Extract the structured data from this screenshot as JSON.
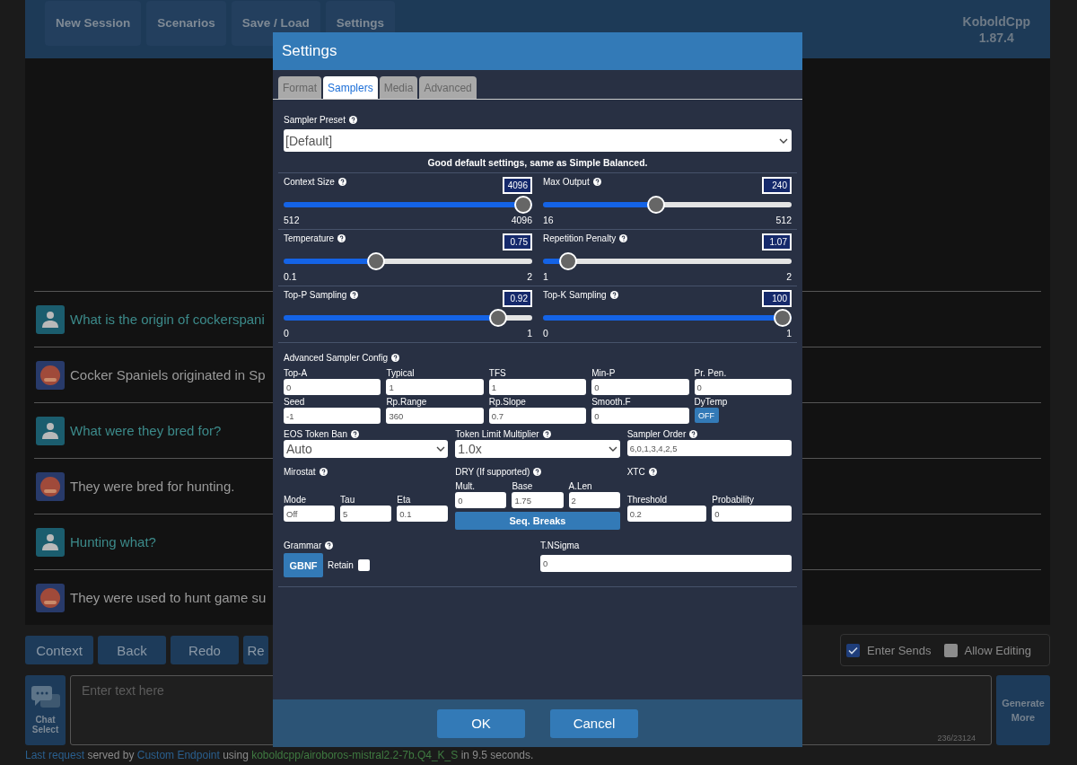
{
  "header": {
    "nav": [
      "New Session",
      "Scenarios",
      "Save / Load",
      "Settings"
    ],
    "brand": "KoboldCpp",
    "version": "1.87.4"
  },
  "messages": [
    {
      "kind": "user",
      "text": "What is the origin of cockerspani"
    },
    {
      "kind": "bot",
      "text": "Cocker Spaniels originated in Sp"
    },
    {
      "kind": "user",
      "text": "What were they bred for?"
    },
    {
      "kind": "bot",
      "text": "They were bred for hunting."
    },
    {
      "kind": "user",
      "text": "Hunting what?"
    },
    {
      "kind": "bot",
      "text": "They were used to hunt game su"
    }
  ],
  "actions": [
    "Context",
    "Back",
    "Redo",
    "Re"
  ],
  "options": [
    {
      "label": "Enter Sends",
      "checked": true
    },
    {
      "label": "Allow Editing",
      "checked": false
    }
  ],
  "chat_select": "Chat Select",
  "input": {
    "placeholder": "Enter text here",
    "counter": "236/23124"
  },
  "generate_button": "Generate More",
  "status": [
    {
      "kind": "link",
      "text": "Last request"
    },
    {
      "kind": "plain",
      "text": " served by "
    },
    {
      "kind": "link",
      "text": "Custom Endpoint"
    },
    {
      "kind": "plain",
      "text": " using "
    },
    {
      "kind": "model",
      "text": "koboldcpp/airoboros-mistral2.2-7b.Q4_K_S"
    },
    {
      "kind": "plain",
      "text": " in 9.5 seconds."
    }
  ],
  "modal": {
    "title": "Settings",
    "tabs": [
      {
        "label": "Format",
        "selected": false
      },
      {
        "label": "Samplers",
        "selected": true
      },
      {
        "label": "Media",
        "selected": false
      },
      {
        "label": "Advanced",
        "selected": false
      }
    ],
    "preset": {
      "label": "Sampler Preset",
      "value": "[Default]",
      "note": "Good default settings, same as Simple Balanced."
    },
    "sliders": [
      {
        "label": "Context Size",
        "value": "4096",
        "min": "512",
        "max": "4096",
        "level": 1.0
      },
      {
        "label": "Max Output",
        "value": "240",
        "min": "16",
        "max": "512",
        "level": 0.45
      },
      {
        "label": "Temperature",
        "value": "0.75",
        "min": "0.1",
        "max": "2",
        "level": 0.36
      },
      {
        "label": "Repetition Penalty",
        "value": "1.07",
        "min": "1",
        "max": "2",
        "level": 0.07
      },
      {
        "label": "Top-P Sampling",
        "value": "0.92",
        "min": "0",
        "max": "1",
        "level": 0.89
      },
      {
        "label": "Top-K Sampling",
        "value": "100",
        "min": "0",
        "max": "1",
        "level": 1.0
      }
    ],
    "advanced_title": "Advanced Sampler Config",
    "grid": [
      {
        "kind": "input",
        "label": "Top-A",
        "value": "0"
      },
      {
        "kind": "input",
        "label": "Typical",
        "value": "1"
      },
      {
        "kind": "input",
        "label": "TFS",
        "value": "1"
      },
      {
        "kind": "input",
        "label": "Min-P",
        "value": "0"
      },
      {
        "kind": "input",
        "label": "Pr. Pen.",
        "value": "0"
      },
      {
        "kind": "input",
        "label": "Seed",
        "value": "-1"
      },
      {
        "kind": "input",
        "label": "Rp.Range",
        "value": "360"
      },
      {
        "kind": "input",
        "label": "Rp.Slope",
        "value": "0.7"
      },
      {
        "kind": "input",
        "label": "Smooth.F",
        "value": "0"
      },
      {
        "kind": "toggle",
        "label": "DyTemp",
        "value": "OFF",
        "on": false
      }
    ],
    "row3": [
      {
        "kind": "select",
        "label": "EOS Token Ban",
        "value": "Auto"
      },
      {
        "kind": "select",
        "label": "Token Limit Multiplier",
        "value": "1.0x"
      },
      {
        "kind": "input",
        "label": "Sampler Order",
        "value": "6,0,1,3,4,2,5"
      }
    ],
    "mirostat": {
      "title": "Mirostat",
      "fields": [
        {
          "label": "Mode",
          "value": "Off"
        },
        {
          "label": "Tau",
          "value": "5"
        },
        {
          "label": "Eta",
          "value": "0.1"
        }
      ]
    },
    "dry": {
      "title": "DRY (If supported)",
      "fields": [
        {
          "label": "Mult.",
          "value": "0"
        },
        {
          "label": "Base",
          "value": "1.75"
        },
        {
          "label": "A.Len",
          "value": "2"
        }
      ],
      "button": "Seq. Breaks"
    },
    "xtc": {
      "title": "XTC",
      "fields": [
        {
          "label": "Threshold",
          "value": "0.2"
        },
        {
          "label": "Probability",
          "value": "0"
        }
      ]
    },
    "grammar": {
      "title": "Grammar",
      "button": "GBNF",
      "retain_label": "Retain",
      "retain": false
    },
    "nsigma": {
      "label": "T.NSigma",
      "value": "0"
    },
    "buttons": [
      "OK",
      "Cancel"
    ]
  }
}
